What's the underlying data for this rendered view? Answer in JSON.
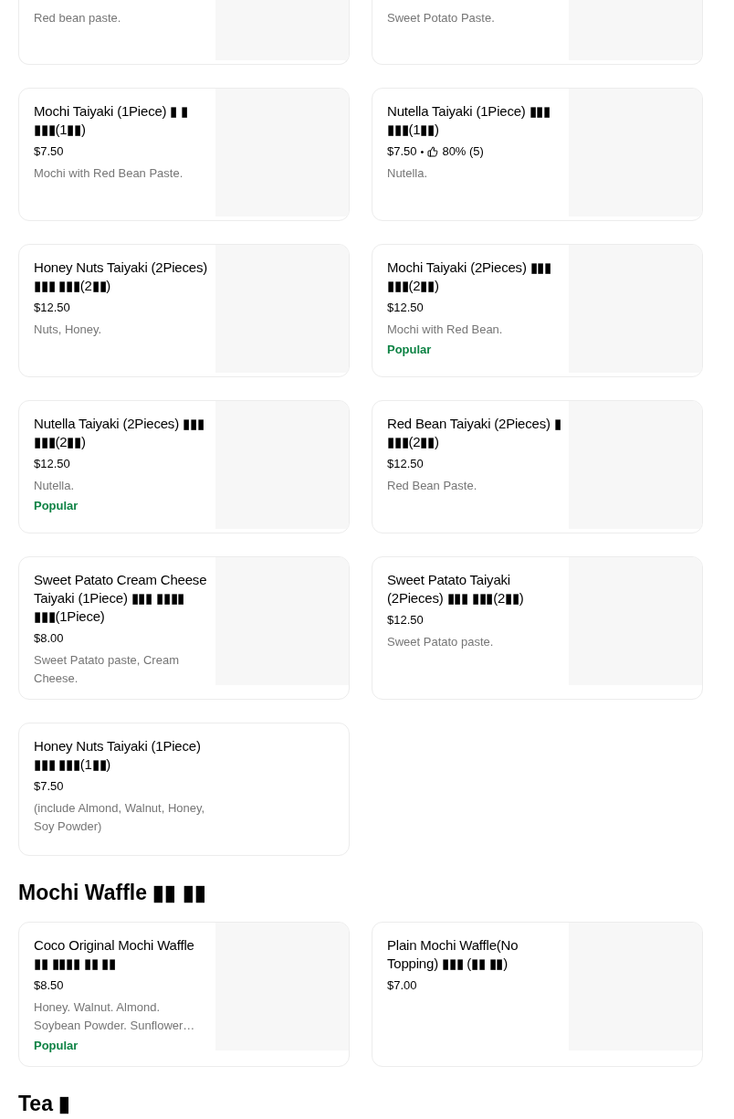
{
  "cut_off_items": [
    {
      "description": "Red bean paste."
    },
    {
      "description": "Sweet Potato Paste."
    }
  ],
  "sections": [
    {
      "items": [
        {
          "title": "Mochi Taiyaki (1Piece) ▮ ▮ ▮▮▮(1▮▮)",
          "price": "$7.50",
          "description": "Mochi with Red Bean Paste.",
          "image": true
        },
        {
          "title": "Nutella Taiyaki (1Piece) ▮▮▮ ▮▮▮(1▮▮)",
          "price": "$7.50",
          "separator": "•",
          "rating": "80% (5)",
          "description": "Nutella.",
          "image": true
        },
        {
          "title": "Honey Nuts Taiyaki (2Pieces) ▮▮▮ ▮▮▮(2▮▮)",
          "price": "$12.50",
          "description": "Nuts, Honey.",
          "image": true
        },
        {
          "title": "Mochi Taiyaki (2Pieces) ▮▮▮ ▮▮▮(2▮▮)",
          "price": "$12.50",
          "description": "Mochi with Red Bean.",
          "badge": "Popular",
          "image": true
        },
        {
          "title": "Nutella Taiyaki (2Pieces) ▮▮▮ ▮▮▮(2▮▮)",
          "price": "$12.50",
          "description": "Nutella.",
          "badge": "Popular",
          "image": true
        },
        {
          "title": "Red Bean Taiyaki (2Pieces) ▮ ▮▮▮(2▮▮)",
          "price": "$12.50",
          "description": "Red Bean Paste.",
          "image": true
        },
        {
          "title": "Sweet Patato Cream Cheese Taiyaki (1Piece) ▮▮▮ ▮▮▮▮ ▮▮▮(1Piece)",
          "price": "$8.00",
          "description": "Sweet Patato paste, Cream Cheese.",
          "image": true
        },
        {
          "title": "Sweet Patato Taiyaki (2Pieces) ▮▮▮ ▮▮▮(2▮▮)",
          "price": "$12.50",
          "description": "Sweet Patato paste.",
          "image": true
        },
        {
          "title": "Honey Nuts Taiyaki (1Piece) ▮▮▮ ▮▮▮(1▮▮)",
          "price": "$7.50",
          "description": "(include Almond, Walnut, Honey, Soy Powder)",
          "image": false
        }
      ]
    },
    {
      "heading": "Mochi Waffle ▮▮ ▮▮",
      "items": [
        {
          "title": "Coco Original Mochi Waffle ▮▮ ▮▮▮▮ ▮▮ ▮▮",
          "price": "$8.50",
          "description": "Honey. Walnut. Almond. Soybean Powder. Sunflower…",
          "badge": "Popular",
          "image": true
        },
        {
          "title": "Plain Mochi Waffle(No Topping) ▮▮▮ (▮▮ ▮▮)",
          "price": "$7.00",
          "image": true
        }
      ]
    },
    {
      "heading": "Tea ▮"
    }
  ]
}
